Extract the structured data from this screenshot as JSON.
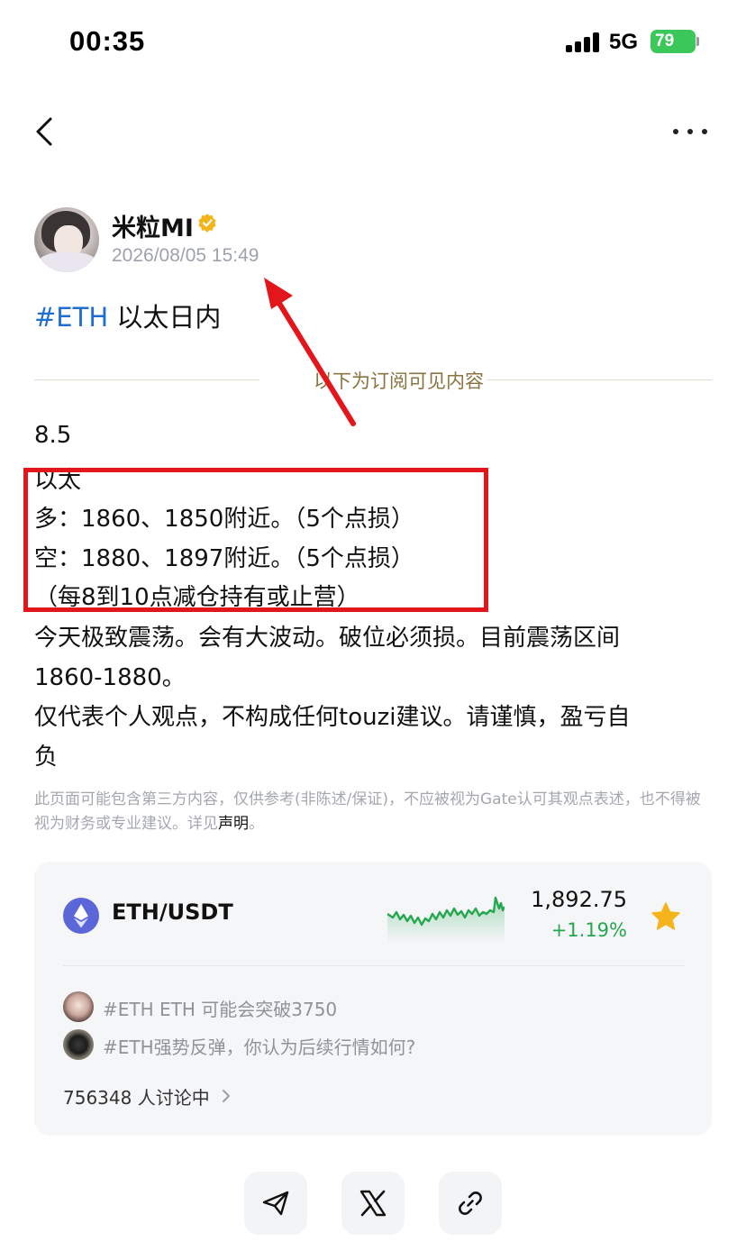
{
  "status_bar": {
    "time": "00:35",
    "network": "5G",
    "battery": "79"
  },
  "author": {
    "name": "米粒MI",
    "timestamp": "2026/08/05 15:49"
  },
  "post": {
    "tag": "#ETH",
    "title_text": " 以太日内",
    "subscription_divider": "以下为订阅可见内容",
    "lines": [
      "8.5",
      "以太",
      "多：1860、1850附近。（5个点损）",
      "空：1880、1897附近。（5个点损）",
      "（每8到10点减仓持有或止营）",
      "今天极致震荡。会有大波动。破位必须损。目前震荡区间",
      "1860-1880。",
      "仅代表个人观点，不构成任何touzi建议。请谨慎，盈亏自",
      "负"
    ],
    "disclaimer": "此页面可能包含第三方内容，仅供参考(非陈述/保证)，不应被视为Gate认可其观点表述，也不得被视为财务或专业建议。详见",
    "disclaimer_link": "声明",
    "disclaimer_end": "。"
  },
  "market": {
    "pair": "ETH/USDT",
    "price": "1,892.75",
    "change": "+1.19%",
    "topics": [
      "#ETH ETH 可能会突破3750",
      "#ETH强势反弹，你认为后续行情如何?"
    ],
    "discussion_count": "756348 人讨论中"
  },
  "colors": {
    "tag_blue": "#1f6fd1",
    "positive_green": "#25a750",
    "annotation_red": "#e3161b",
    "divider_gold": "#8a7440"
  }
}
